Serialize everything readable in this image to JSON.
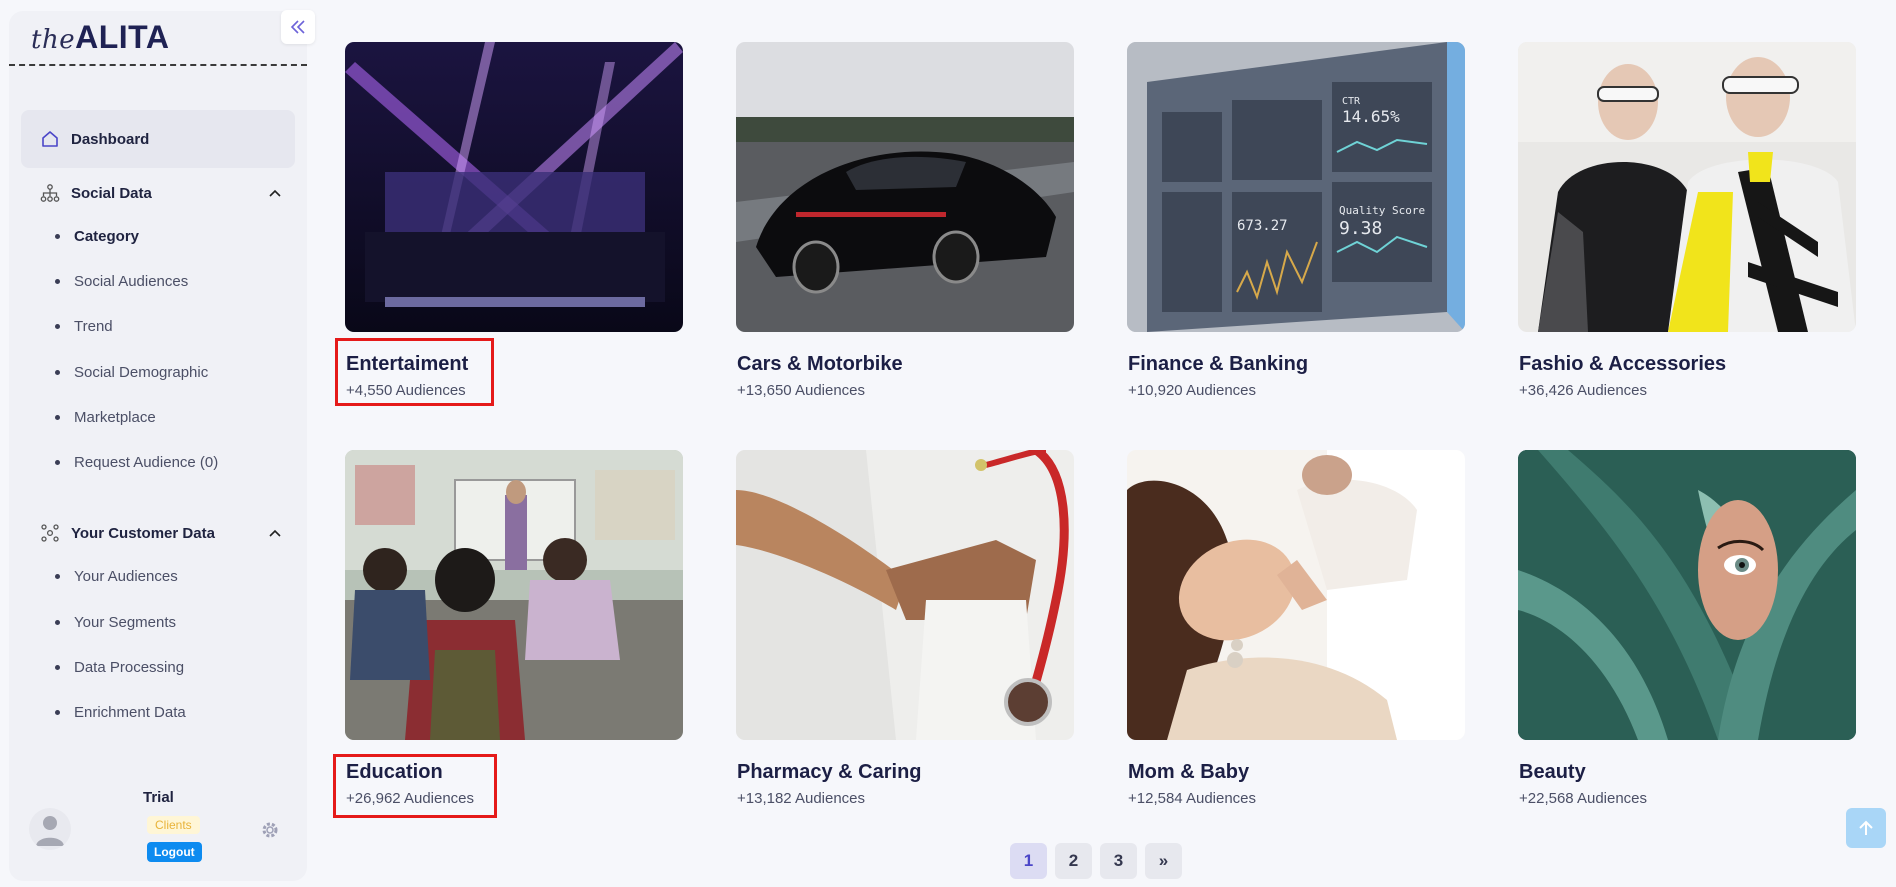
{
  "brand": {
    "prefix": "the",
    "name": "ALITA"
  },
  "sidebar": {
    "dashboard": "Dashboard",
    "social_data": {
      "label": "Social Data",
      "items": [
        "Category",
        "Social Audiences",
        "Trend",
        "Social Demographic",
        "Marketplace",
        "Request Audience (0)"
      ]
    },
    "customer_data": {
      "label": "Your Customer Data",
      "items": [
        "Your Audiences",
        "Your Segments",
        "Data Processing",
        "Enrichment Data"
      ]
    }
  },
  "user": {
    "name": "Trial",
    "role": "Clients",
    "logout": "Logout"
  },
  "categories": [
    {
      "title": "Entertaiment",
      "audiences": "+4,550 Audiences"
    },
    {
      "title": "Cars & Motorbike",
      "audiences": "+13,650 Audiences"
    },
    {
      "title": "Finance & Banking",
      "audiences": "+10,920 Audiences"
    },
    {
      "title": "Fashio & Accessories",
      "audiences": "+36,426 Audiences"
    },
    {
      "title": "Education",
      "audiences": "+26,962 Audiences"
    },
    {
      "title": "Pharmacy & Caring",
      "audiences": "+13,182 Audiences"
    },
    {
      "title": "Mom & Baby",
      "audiences": "+12,584 Audiences"
    },
    {
      "title": "Beauty",
      "audiences": "+22,568 Audiences"
    }
  ],
  "finance_image_text": {
    "ctr": "CTR",
    "ctr_value": "14.65%",
    "quality_label": "Quality Score",
    "quality_value": "9.38",
    "cost_value": "673.27"
  },
  "pagination": {
    "pages": [
      "1",
      "2",
      "3"
    ],
    "next": "»",
    "current": "1"
  },
  "colors": {
    "accent": "#6d63d9",
    "highlight": "#e51a1a",
    "logout": "#0d8bf0",
    "active_page": "#4b46c8"
  }
}
